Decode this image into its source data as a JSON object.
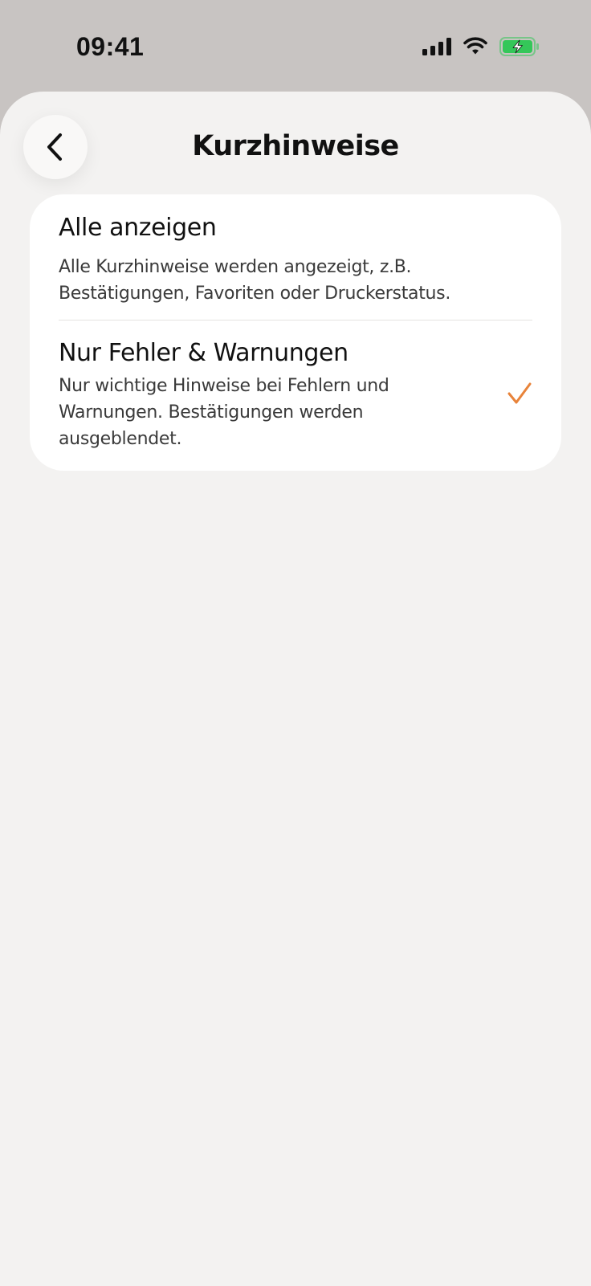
{
  "status_bar": {
    "time": "09:41"
  },
  "header": {
    "title": "Kurzhinweise",
    "back_icon": "chevron-left-icon"
  },
  "options": [
    {
      "title": "Alle anzeigen",
      "description": "Alle Kurzhinweise werden angezeigt, z.B. Bestätigungen, Favoriten oder Druckerstatus.",
      "selected": false
    },
    {
      "title": "Nur Fehler & Warnungen",
      "description": "Nur wichtige Hinweise bei Fehlern und Warnungen. Bestätigungen werden ausgeblendet.",
      "selected": true
    }
  ],
  "colors": {
    "accent": "#e8833a",
    "battery": "#34c759",
    "sheet_background": "#f3f2f1",
    "card_background": "#ffffff"
  }
}
